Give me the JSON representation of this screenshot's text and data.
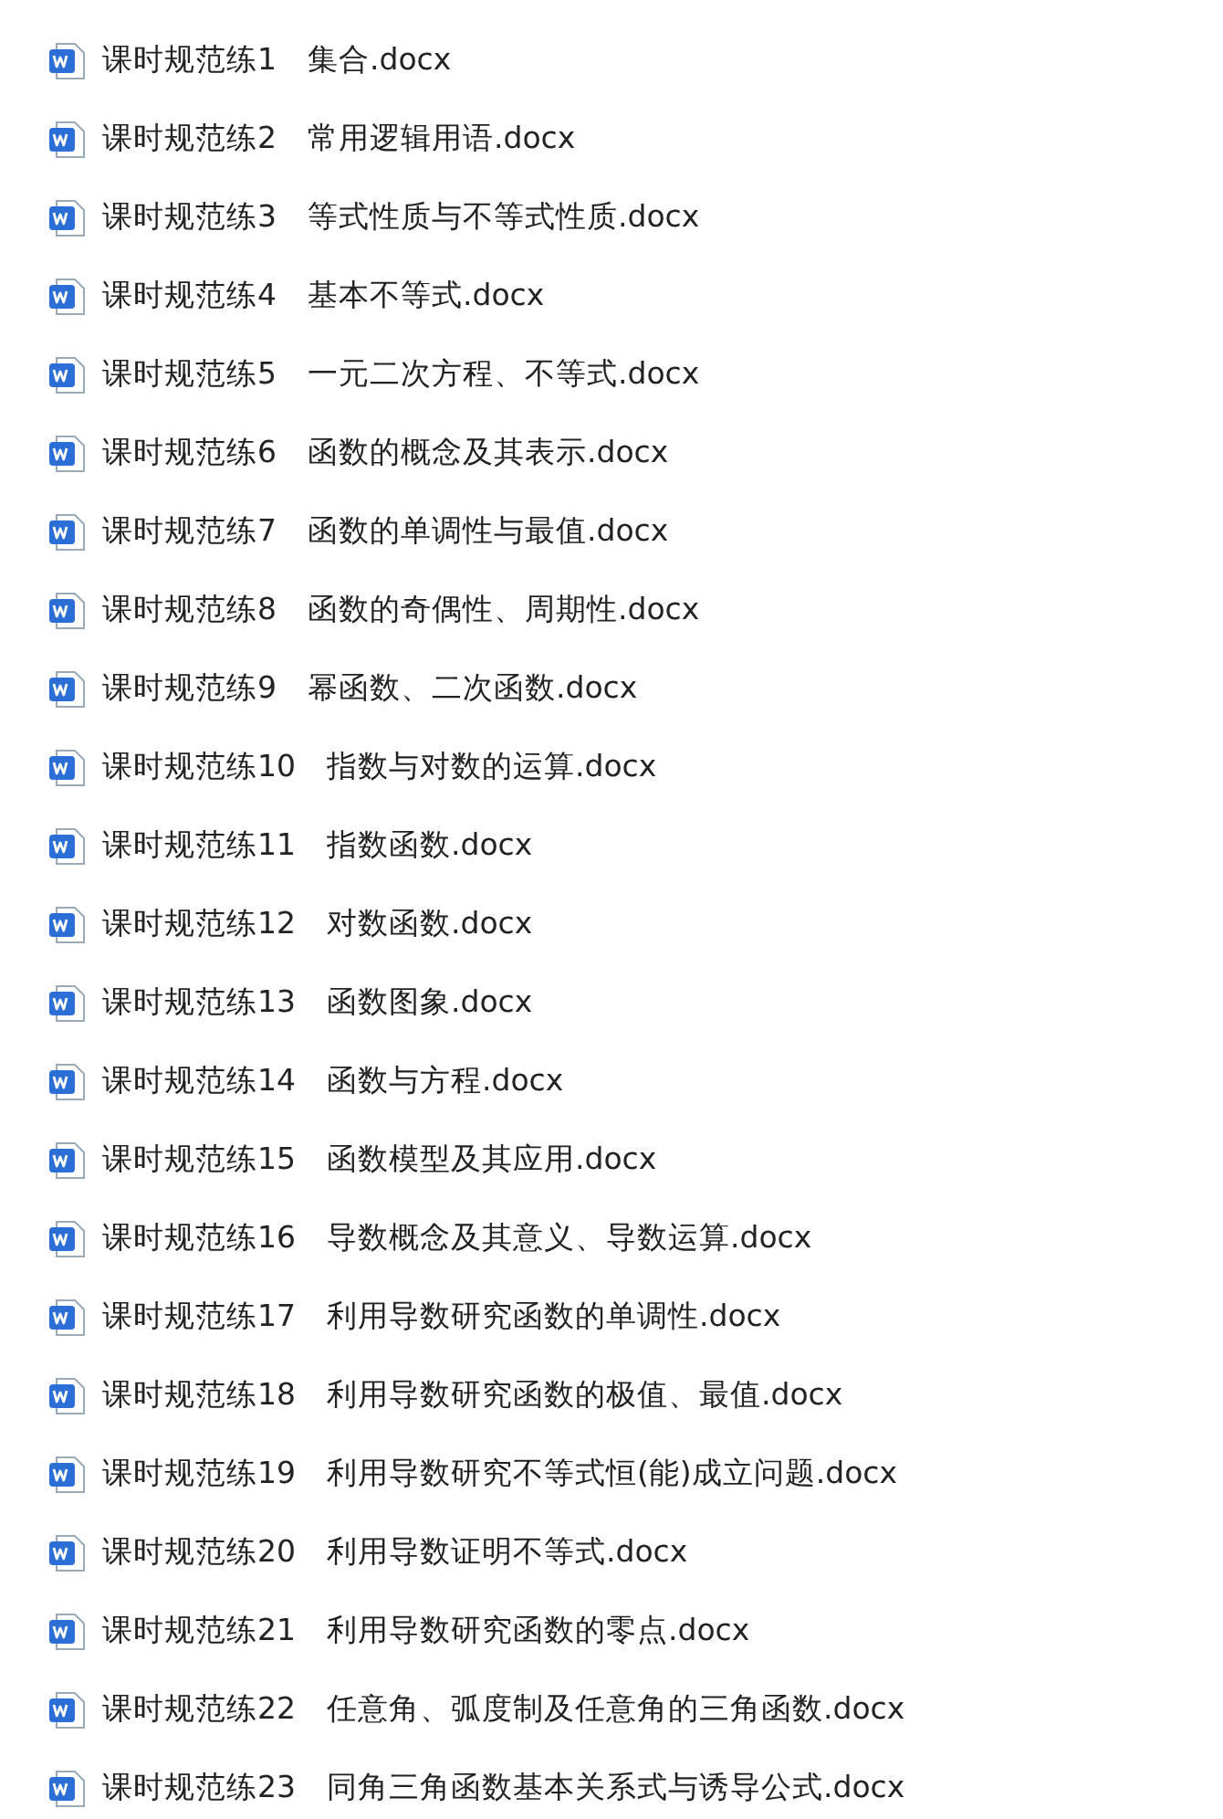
{
  "files": [
    {
      "name": "课时规范练1　集合.docx"
    },
    {
      "name": "课时规范练2　常用逻辑用语.docx"
    },
    {
      "name": "课时规范练3　等式性质与不等式性质.docx"
    },
    {
      "name": "课时规范练4　基本不等式.docx"
    },
    {
      "name": "课时规范练5　一元二次方程、不等式.docx"
    },
    {
      "name": "课时规范练6　函数的概念及其表示.docx"
    },
    {
      "name": "课时规范练7　函数的单调性与最值.docx"
    },
    {
      "name": "课时规范练8　函数的奇偶性、周期性.docx"
    },
    {
      "name": "课时规范练9　幂函数、二次函数.docx"
    },
    {
      "name": "课时规范练10　指数与对数的运算.docx"
    },
    {
      "name": "课时规范练11　指数函数.docx"
    },
    {
      "name": "课时规范练12　对数函数.docx"
    },
    {
      "name": "课时规范练13　函数图象.docx"
    },
    {
      "name": "课时规范练14　函数与方程.docx"
    },
    {
      "name": "课时规范练15　函数模型及其应用.docx"
    },
    {
      "name": "课时规范练16　导数概念及其意义、导数运算.docx"
    },
    {
      "name": "课时规范练17　利用导数研究函数的单调性.docx"
    },
    {
      "name": "课时规范练18　利用导数研究函数的极值、最值.docx"
    },
    {
      "name": "课时规范练19　利用导数研究不等式恒(能)成立问题.docx"
    },
    {
      "name": "课时规范练20　利用导数证明不等式.docx"
    },
    {
      "name": "课时规范练21　利用导数研究函数的零点.docx"
    },
    {
      "name": "课时规范练22　任意角、弧度制及任意角的三角函数.docx"
    },
    {
      "name": "课时规范练23　同角三角函数基本关系式与诱导公式.docx"
    }
  ]
}
